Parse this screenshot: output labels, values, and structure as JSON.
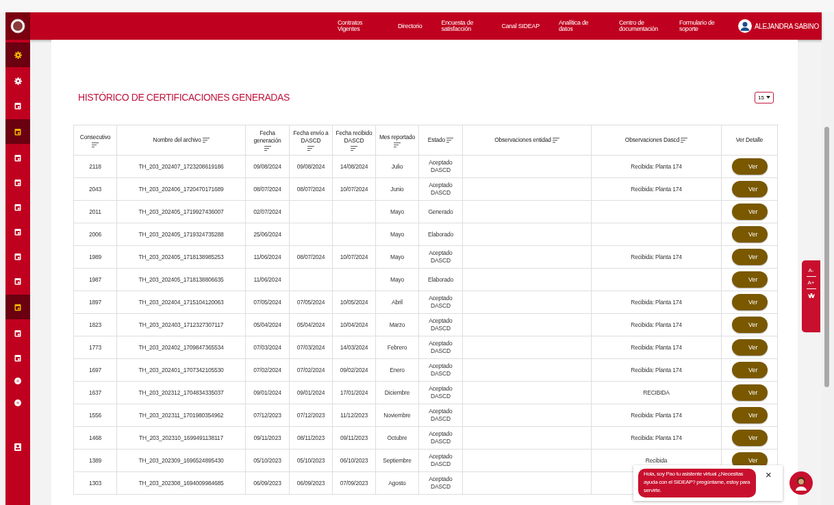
{
  "sidebar": {
    "items": [
      {
        "kind": "gear",
        "selected": true
      },
      {
        "kind": "gear",
        "selected": false
      },
      {
        "kind": "calendar",
        "selected": false
      },
      {
        "kind": "calendar",
        "selected": true
      },
      {
        "kind": "calendar",
        "selected": false
      },
      {
        "kind": "calendar",
        "selected": false
      },
      {
        "kind": "calendar",
        "selected": false
      },
      {
        "kind": "calendar",
        "selected": false
      },
      {
        "kind": "calendar",
        "selected": false
      },
      {
        "kind": "calendar",
        "selected": false
      },
      {
        "kind": "calendar",
        "selected": true
      },
      {
        "kind": "calendar",
        "selected": false
      },
      {
        "kind": "calendar",
        "selected": false
      },
      {
        "kind": "circle",
        "selected": false
      },
      {
        "kind": "circle",
        "selected": false
      },
      {
        "kind": "badge",
        "selected": false
      }
    ]
  },
  "nav": {
    "items": [
      "Contratos Vigentes",
      "Directorio",
      "Encuesta de satisfacción",
      "Canal SIDEAP",
      "Analítica de datos",
      "Centro de documentación",
      "Formulario de soporte"
    ],
    "user": "ALEJANDRA SABINO"
  },
  "page": {
    "title": "HISTÓRICO DE CERTIFICACIONES GENERADAS",
    "page_size": "15"
  },
  "table": {
    "columns": [
      {
        "label": "Consecutivo",
        "sortable": true
      },
      {
        "label": "Nombre del archivo",
        "sortable": true
      },
      {
        "label": "Fecha generación",
        "sortable": true
      },
      {
        "label": "Fecha envío a DASCD",
        "sortable": true
      },
      {
        "label": "Fecha recibido DASCD",
        "sortable": true
      },
      {
        "label": "Mes reportado",
        "sortable": true
      },
      {
        "label": "Estado",
        "sortable": true
      },
      {
        "label": "Observaciones entidad",
        "sortable": true
      },
      {
        "label": "Observaciones Dascd",
        "sortable": true
      },
      {
        "label": "Ver Detalle",
        "sortable": false
      }
    ],
    "rows": [
      {
        "cells": [
          "2118",
          "TH_203_202407_1723208619186",
          "09/08/2024",
          "09/08/2024",
          "14/08/2024",
          "Julio",
          "Aceptado DASCD",
          "",
          "Recibida: Planta 174"
        ],
        "action": "Ver"
      },
      {
        "cells": [
          "2043",
          "TH_203_202406_1720470171689",
          "08/07/2024",
          "08/07/2024",
          "10/07/2024",
          "Junio",
          "Aceptado DASCD",
          "",
          "Recibida: Planta 174"
        ],
        "action": "Ver"
      },
      {
        "cells": [
          "2011",
          "TH_203_202405_1719927436007",
          "02/07/2024",
          "",
          "",
          "Mayo",
          "Generado",
          "",
          ""
        ],
        "action": "Ver"
      },
      {
        "cells": [
          "2006",
          "TH_203_202405_1719324735288",
          "25/06/2024",
          "",
          "",
          "Mayo",
          "Elaborado",
          "",
          ""
        ],
        "action": "Ver"
      },
      {
        "cells": [
          "1989",
          "TH_203_202405_1718138985253",
          "11/06/2024",
          "08/07/2024",
          "10/07/2024",
          "Mayo",
          "Aceptado DASCD",
          "",
          "Recibida: Planta 174"
        ],
        "action": "Ver"
      },
      {
        "cells": [
          "1987",
          "TH_203_202405_1718138806635",
          "11/06/2024",
          "",
          "",
          "Mayo",
          "Elaborado",
          "",
          ""
        ],
        "action": "Ver"
      },
      {
        "cells": [
          "1897",
          "TH_203_202404_1715104120063",
          "07/05/2024",
          "07/05/2024",
          "10/05/2024",
          "Abril",
          "Aceptado DASCD",
          "",
          "Recibida: Planta 174"
        ],
        "action": "Ver"
      },
      {
        "cells": [
          "1823",
          "TH_203_202403_1712327307117",
          "05/04/2024",
          "05/04/2024",
          "10/04/2024",
          "Marzo",
          "Aceptado DASCD",
          "",
          "Recibida: Planta 174"
        ],
        "action": "Ver"
      },
      {
        "cells": [
          "1773",
          "TH_203_202402_1709847365534",
          "07/03/2024",
          "07/03/2024",
          "14/03/2024",
          "Febrero",
          "Aceptado DASCD",
          "",
          "Recibida: Planta 174"
        ],
        "action": "Ver"
      },
      {
        "cells": [
          "1697",
          "TH_203_202401_1707342105530",
          "07/02/2024",
          "07/02/2024",
          "09/02/2024",
          "Enero",
          "Aceptado DASCD",
          "",
          "Recibida: Planta 174"
        ],
        "action": "Ver"
      },
      {
        "cells": [
          "1637",
          "TH_203_202312_1704834335037",
          "09/01/2024",
          "09/01/2024",
          "17/01/2024",
          "Diciembre",
          "Aceptado DASCD",
          "",
          "RECIBIDA"
        ],
        "action": "Ver"
      },
      {
        "cells": [
          "1556",
          "TH_203_202311_1701980354962",
          "07/12/2023",
          "07/12/2023",
          "11/12/2023",
          "Noviembre",
          "Aceptado DASCD",
          "",
          "Recibida: Planta 174"
        ],
        "action": "Ver"
      },
      {
        "cells": [
          "1468",
          "TH_203_202310_1699491138117",
          "09/11/2023",
          "08/11/2023",
          "09/11/2023",
          "Octubre",
          "Aceptado DASCD",
          "",
          "Recibida: Planta 174"
        ],
        "action": "Ver"
      },
      {
        "cells": [
          "1389",
          "TH_203_202309_1696524895430",
          "05/10/2023",
          "05/10/2023",
          "06/10/2023",
          "Septiembre",
          "Aceptado DASCD",
          "",
          "Recibida"
        ],
        "action": "Ver"
      },
      {
        "cells": [
          "1303",
          "TH_203_202308_1694009984685",
          "06/09/2023",
          "06/09/2023",
          "07/09/2023",
          "Agosto",
          "Aceptado DASCD",
          "",
          ""
        ]
      }
    ]
  },
  "accessibility": {
    "decrease": "A-",
    "increase": "A+"
  },
  "chat": {
    "message": "Hola, soy Pao tu asistente virtual ¿Necesitas ayuda con el SIDEAP? pregúntame, estoy para servirte.",
    "close": "×"
  }
}
